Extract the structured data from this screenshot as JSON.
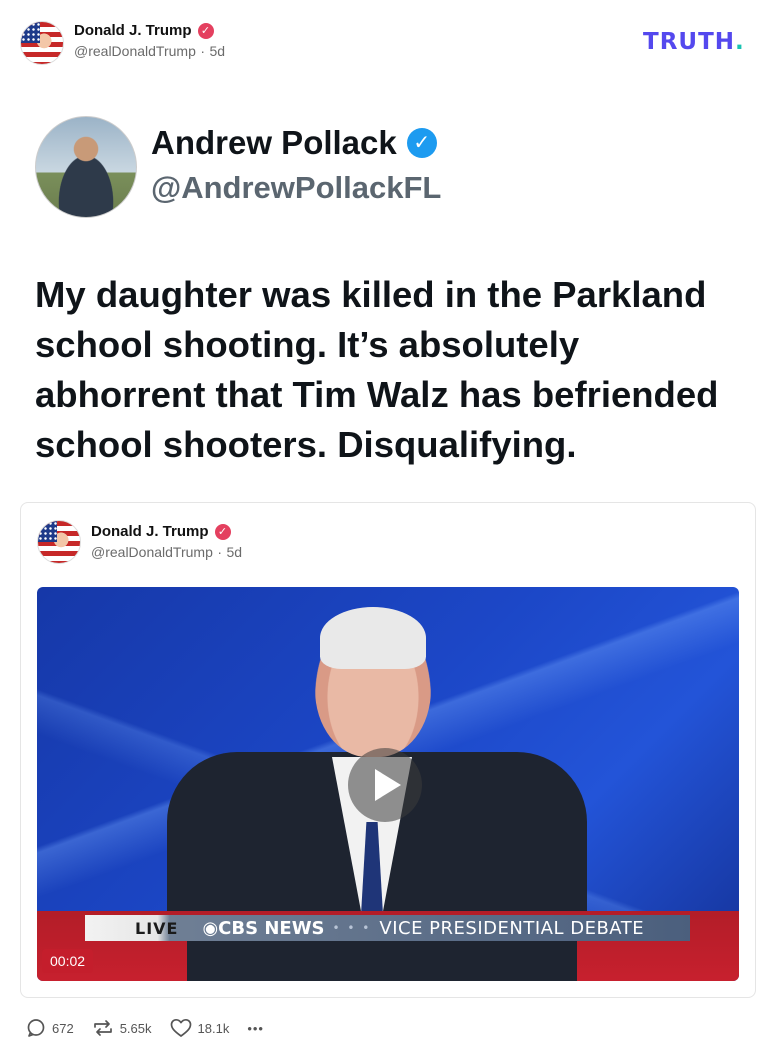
{
  "post": {
    "author_name": "Donald J. Trump",
    "author_handle": "@realDonaldTrump",
    "age": "5d",
    "separator": "·"
  },
  "brand": {
    "logo_text": "TRUTH",
    "logo_dot": "."
  },
  "embedded_tweet": {
    "name": "Andrew Pollack",
    "handle": "@AndrewPollackFL",
    "text": "My daughter was killed in the Parkland school shooting. It’s absolutely abhorrent that Tim Walz has befriended school shooters. Disqualifying."
  },
  "quoted_post": {
    "author_name": "Donald J. Trump",
    "author_handle": "@realDonaldTrump",
    "age": "5d",
    "separator": "·",
    "video": {
      "chyron_live": "LIVE",
      "chyron_network": "◉CBS NEWS",
      "chyron_dots": "• • •",
      "chyron_topic": "VICE PRESIDENTIAL DEBATE",
      "timestamp": "00:02"
    }
  },
  "actions": {
    "replies": "672",
    "retruths": "5.65k",
    "likes": "18.1k",
    "more": "•••"
  },
  "colors": {
    "truth_brand": "#5448ee",
    "truth_dot": "#19c3b2",
    "verified_pink": "#e4405f",
    "verified_blue": "#1d9bf0"
  },
  "icons": [
    "verified-icon",
    "play-icon",
    "reply-icon",
    "retruth-icon",
    "like-icon",
    "more-icon"
  ]
}
